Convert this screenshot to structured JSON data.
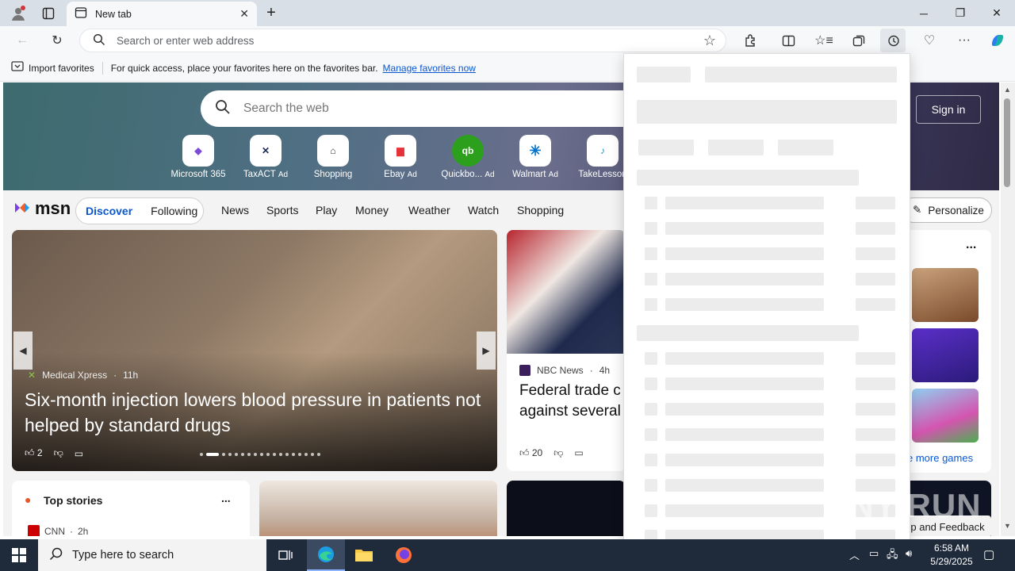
{
  "browser": {
    "tab_title": "New tab",
    "address_placeholder": "Search or enter web address",
    "favorites_bar": {
      "import_label": "Import favorites",
      "hint": "For quick access, place your favorites here on the favorites bar.",
      "manage_link": "Manage favorites now"
    }
  },
  "msn": {
    "search_placeholder": "Search the web",
    "sign_in": "Sign in",
    "logo_text": "msn",
    "quick_links": [
      {
        "label": "Microsoft 365",
        "ad": ""
      },
      {
        "label": "TaxACT",
        "ad": "Ad"
      },
      {
        "label": "Shopping",
        "ad": ""
      },
      {
        "label": "Ebay",
        "ad": "Ad"
      },
      {
        "label": "Quickbo...",
        "ad": "Ad"
      },
      {
        "label": "Walmart",
        "ad": "Ad"
      },
      {
        "label": "TakeLesson",
        "ad": ""
      }
    ],
    "pill_tabs": [
      "Discover",
      "Following"
    ],
    "nav": [
      "News",
      "Sports",
      "Play",
      "Money",
      "Weather",
      "Watch",
      "Shopping"
    ],
    "personalize": "Personalize",
    "hero": {
      "source": "Medical Xpress",
      "age": "11h",
      "title": "Six-month injection lowers blood pressure in patients not helped by standard drugs",
      "likes": "2"
    },
    "news": {
      "source": "NBC News",
      "age": "4h",
      "title_line1": "Federal trade c",
      "title_line2": "against several",
      "likes": "20"
    },
    "games": {
      "more": "...",
      "see_more": "e more games"
    },
    "top_stories": {
      "title": "Top stories",
      "more": "...",
      "first_source": "CNN",
      "first_age": "2h"
    },
    "feedback": "p and Feedback"
  },
  "taskbar": {
    "search_placeholder": "Type here to search",
    "time": "6:58 AM",
    "date": "5/29/2025"
  },
  "watermark": "ANY RUN",
  "colors": {
    "accent": "#0b57d0",
    "taskbar": "#1f2a3a"
  }
}
